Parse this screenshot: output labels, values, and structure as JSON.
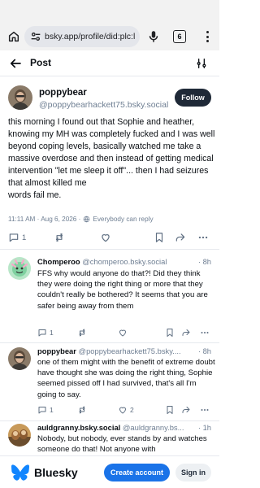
{
  "browser": {
    "url": "bsky.app/profile/did:plc:l",
    "tab_count": "6"
  },
  "header": {
    "title": "Post"
  },
  "main_post": {
    "author_name": "poppybear",
    "author_handle": "@poppybearhackett75.bsky.social",
    "follow_label": "Follow",
    "text": "this morning I found out that Sophie and heather, knowing my MH was completely fucked and I was well beyond coping levels, basically watched me take a massive overdose and then instead of getting medical intervention \"let me sleep it off\"... then I had seizures that almost killed me\nwords fail me.",
    "timestamp": "11:11 AM · Aug 6, 2026 · ",
    "reply_setting": "Everybody can reply",
    "reply_count": "1"
  },
  "replies": [
    {
      "name": "Chomperoo",
      "handle": "@chomperoo.bsky.social",
      "time": "· 8h",
      "text": "FFS why would anyone do that?! Did they think they were doing the right thing or more that they couldn't really be bothered? It seems that you are safer being away from them",
      "reply_count": "1",
      "like_count": ""
    },
    {
      "name": "poppybear",
      "handle": "@poppybearhackett75.bsky....",
      "time": "· 8h",
      "text": "one of them might with the benefit of extreme doubt have thought she was doing the right thing, Sophie seemed pissed off I had survived, that's all I'm going to say.",
      "reply_count": "1",
      "like_count": "2"
    },
    {
      "name": "auldgranny.bsky.social",
      "handle": "@auldgranny.bs...",
      "time": "· 1h",
      "text": "Nobody, but nobody, ever stands by and watches someone do that! Not anyone with",
      "reply_count": "",
      "like_count": ""
    }
  ],
  "bottom_bar": {
    "brand": "Bluesky",
    "create_account": "Create account",
    "sign_in": "Sign in"
  },
  "colors": {
    "brand_blue": "#1185fe",
    "primary_button": "#1a73e8",
    "follow_button": "#1f2937"
  }
}
